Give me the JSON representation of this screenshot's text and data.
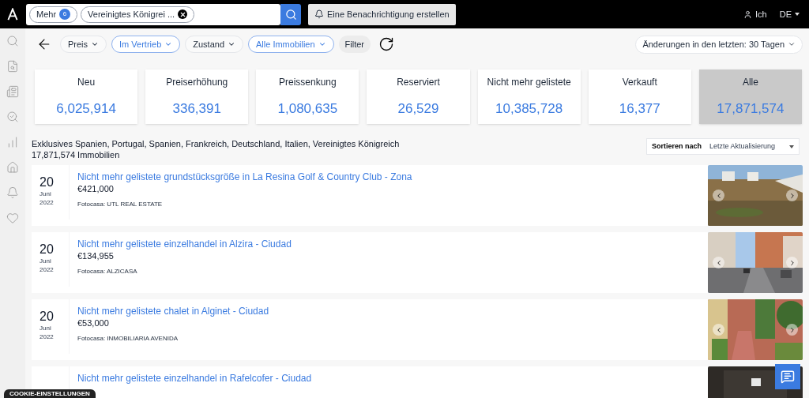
{
  "search": {
    "chips": [
      {
        "label": "Mehr",
        "count": "6"
      },
      {
        "label": "Vereinigtes Königrei ..."
      }
    ]
  },
  "alert_button": "Eine Benachrichtigung erstellen",
  "user": "Ich",
  "language": "DE",
  "filters": [
    {
      "label": "Preis",
      "active": false
    },
    {
      "label": "Im Vertrieb",
      "active": true
    },
    {
      "label": "Zustand",
      "active": false
    },
    {
      "label": "Alle Immobilien",
      "active": true
    }
  ],
  "filter_button": "Filter",
  "period": "Änderungen in den letzten: 30 Tagen",
  "stats": [
    {
      "label": "Neu",
      "value": "6,025,914",
      "selected": false
    },
    {
      "label": "Preiserhöhung",
      "value": "336,391",
      "selected": false
    },
    {
      "label": "Preissenkung",
      "value": "1,080,635",
      "selected": false
    },
    {
      "label": "Reserviert",
      "value": "26,529",
      "selected": false
    },
    {
      "label": "Nicht mehr gelistete",
      "value": "10,385,728",
      "selected": false
    },
    {
      "label": "Verkauft",
      "value": "16,377",
      "selected": false
    },
    {
      "label": "Alle",
      "value": "17,871,574",
      "selected": true
    }
  ],
  "summary": {
    "regions": "Exklusives Spanien, Portugal, Spanien, Frankreich, Deutschland, Italien, Vereinigtes Königreich",
    "count": "17,871,574 Immobilien"
  },
  "sort": {
    "label": "Sortieren nach",
    "value": "Letzte Aktualisierung"
  },
  "listings": [
    {
      "day": "20",
      "month": "Juni",
      "year": "2022",
      "title": "Nicht mehr gelistete grundstücksgröße in La Resina Golf & Country Club - Zona",
      "price": "€421,000",
      "source": "Fotocasa: UTL REAL ESTATE"
    },
    {
      "day": "20",
      "month": "Juni",
      "year": "2022",
      "title": "Nicht mehr gelistete einzelhandel in Alzira - Ciudad",
      "price": "€134,955",
      "source": "Fotocasa: ALZICASA"
    },
    {
      "day": "20",
      "month": "Juni",
      "year": "2022",
      "title": "Nicht mehr gelistete chalet in Alginet - Ciudad",
      "price": "€53,000",
      "source": "Fotocasa: INMOBILIARIA AVENIDA"
    },
    {
      "title": "Nicht mehr gelistete einzelhandel in Rafelcofer - Ciudad"
    }
  ],
  "cookie_button": "COOKIE-EINSTELLUNGEN"
}
